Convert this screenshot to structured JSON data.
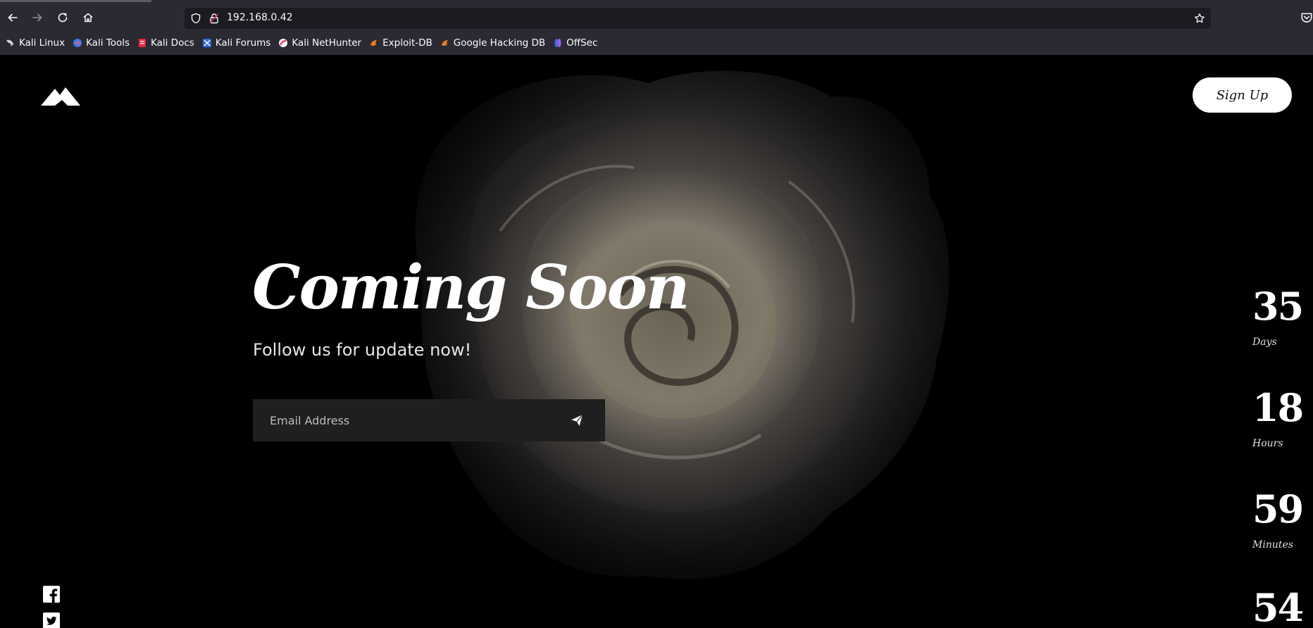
{
  "browser": {
    "url": "192.168.0.42",
    "bookmarks": [
      {
        "label": "Kali Linux",
        "icon": "kali-dragon-icon"
      },
      {
        "label": "Kali Tools",
        "icon": "kali-tools-icon"
      },
      {
        "label": "Kali Docs",
        "icon": "kali-docs-icon"
      },
      {
        "label": "Kali Forums",
        "icon": "kali-forums-icon"
      },
      {
        "label": "Kali NetHunter",
        "icon": "kali-nethunter-icon"
      },
      {
        "label": "Exploit-DB",
        "icon": "exploit-db-icon"
      },
      {
        "label": "Google Hacking DB",
        "icon": "ghdb-icon"
      },
      {
        "label": "OffSec",
        "icon": "offsec-icon"
      }
    ]
  },
  "page": {
    "signup_label": "Sign Up",
    "title": "Coming Soon",
    "subtitle": "Follow us for update now!",
    "email_placeholder": "Email Address",
    "countdown": [
      {
        "value": "35",
        "label": "Days"
      },
      {
        "value": "18",
        "label": "Hours"
      },
      {
        "value": "59",
        "label": "Minutes"
      },
      {
        "value": "54",
        "label": ""
      }
    ],
    "social": [
      "facebook-icon",
      "twitter-icon"
    ]
  },
  "colors": {
    "chrome_bg": "#2b2a33",
    "urlbar_bg": "#1c1b22",
    "page_bg": "#000000",
    "input_bg": "#1f1f1f"
  }
}
